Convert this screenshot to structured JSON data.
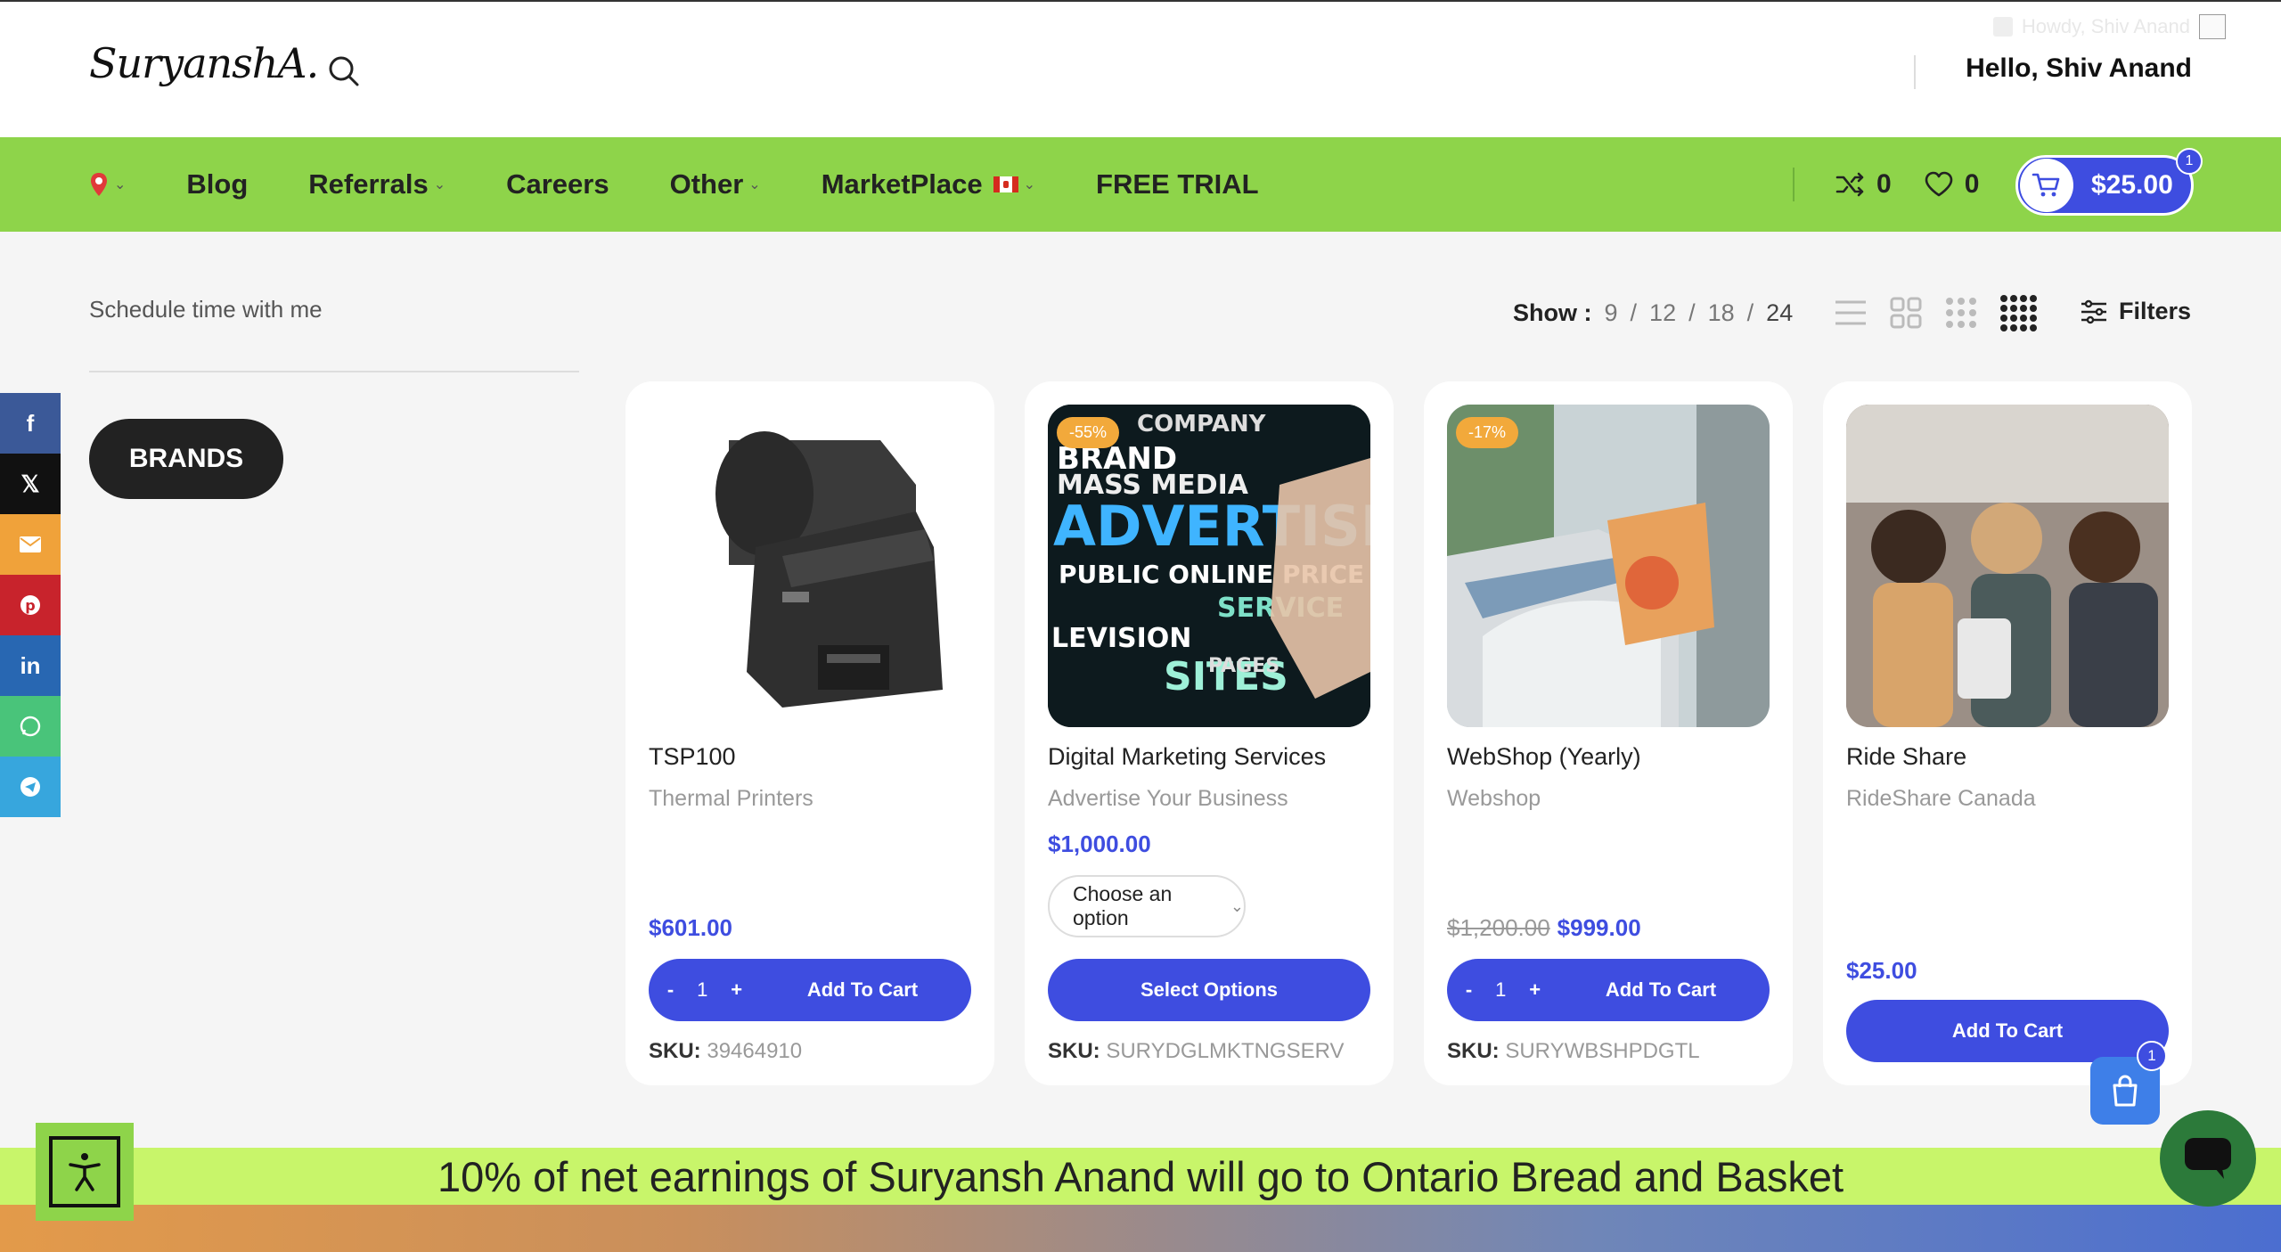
{
  "header": {
    "logo": "SuryanshA.",
    "howdy": "Howdy, Shiv Anand",
    "greeting": "Hello, Shiv Anand"
  },
  "nav": {
    "items": [
      {
        "label": "Blog",
        "dropdown": false
      },
      {
        "label": "Referrals",
        "dropdown": true
      },
      {
        "label": "Careers",
        "dropdown": false
      },
      {
        "label": "Other",
        "dropdown": true
      },
      {
        "label": "MarketPlace",
        "dropdown": true
      },
      {
        "label": "FREE TRIAL",
        "dropdown": false
      }
    ],
    "compare_count": "0",
    "wishlist_count": "0",
    "cart_total": "$25.00",
    "cart_count": "1",
    "accent": "#8ed44a"
  },
  "sidebar": {
    "schedule": "Schedule time with me",
    "brands_button": "BRANDS"
  },
  "social": [
    "facebook",
    "x",
    "email",
    "pinterest",
    "linkedin",
    "whatsapp",
    "telegram"
  ],
  "toolbar": {
    "show_label": "Show :",
    "options": [
      "9",
      "12",
      "18",
      "24"
    ],
    "filters": "Filters"
  },
  "products": [
    {
      "name": "TSP100",
      "category": "Thermal Printers",
      "price": "$601.00",
      "qty": "1",
      "button": "Add To Cart",
      "sku_label": "SKU:",
      "sku": "39464910"
    },
    {
      "name": "Digital Marketing Services",
      "category": "Advertise Your Business",
      "price": "$1,000.00",
      "badge": "-55%",
      "select": "Choose an option",
      "button": "Select Options",
      "sku_label": "SKU:",
      "sku": "SURYDGLMKTNGSERV"
    },
    {
      "name": "WebShop (Yearly)",
      "category": "Webshop",
      "old_price": "$1,200.00",
      "price": "$999.00",
      "badge": "-17%",
      "qty": "1",
      "button": "Add To Cart",
      "sku_label": "SKU:",
      "sku": "SURYWBSHPDGTL"
    },
    {
      "name": "Ride Share",
      "category": "RideShare Canada",
      "price": "$25.00",
      "button": "Add To Cart"
    }
  ],
  "floating": {
    "bag_count": "1"
  },
  "banner": "10% of net earnings of Suryansh Anand will go to Ontario Bread and Basket",
  "colors": {
    "primary": "#3e4de0",
    "green": "#8ed44a",
    "banner": "#c8f56a"
  }
}
